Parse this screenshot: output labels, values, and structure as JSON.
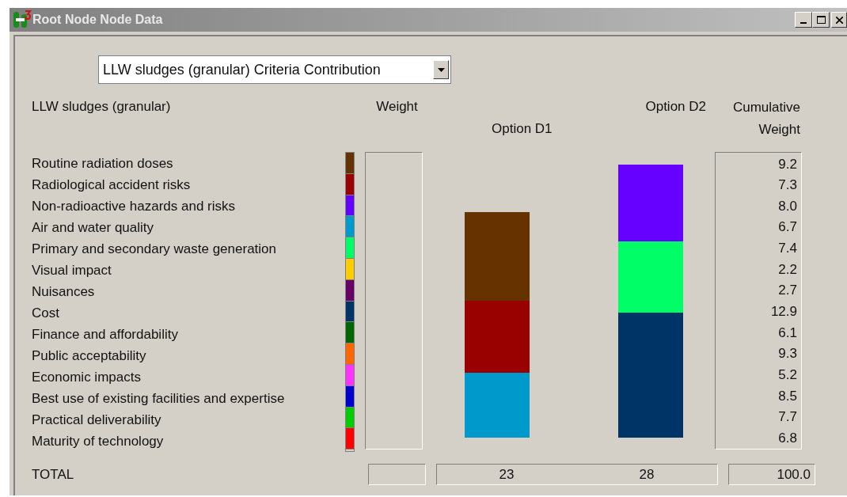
{
  "window": {
    "title": "Root Node Node Data"
  },
  "dropdown": {
    "value": "LLW sludges (granular) Criteria Contribution"
  },
  "headers": {
    "criteria": "LLW sludges (granular)",
    "weight": "Weight",
    "option_1": "Option D1",
    "option_2": "Option D2",
    "cumulative": [
      "Cumulative",
      "Weight"
    ]
  },
  "criteria": [
    {
      "name": "Routine radiation doses",
      "color": "#663300",
      "cumulative": "9.2"
    },
    {
      "name": "Radiological accident risks",
      "color": "#990000",
      "cumulative": "7.3"
    },
    {
      "name": "Non-radioactive hazards and risks",
      "color": "#6600ff",
      "cumulative": "8.0"
    },
    {
      "name": "Air and water quality",
      "color": "#0099cc",
      "cumulative": "6.7"
    },
    {
      "name": "Primary and secondary waste generation",
      "color": "#00ff66",
      "cumulative": "7.4"
    },
    {
      "name": "Visual impact",
      "color": "#ffcc00",
      "cumulative": "2.2"
    },
    {
      "name": "Nuisances",
      "color": "#660066",
      "cumulative": "2.7"
    },
    {
      "name": "Cost",
      "color": "#003366",
      "cumulative": "12.9"
    },
    {
      "name": "Finance and affordability",
      "color": "#006600",
      "cumulative": "6.1"
    },
    {
      "name": "Public acceptability",
      "color": "#ff6600",
      "cumulative": "9.3"
    },
    {
      "name": "Economic impacts",
      "color": "#ff33ff",
      "cumulative": "5.2"
    },
    {
      "name": "Best use of existing facilities and expertise",
      "color": "#0000cc",
      "cumulative": "8.5"
    },
    {
      "name": "Practical deliverability",
      "color": "#00cc00",
      "cumulative": "7.7"
    },
    {
      "name": "Maturity of technology",
      "color": "#ff0000",
      "cumulative": "6.8"
    }
  ],
  "options": [
    {
      "total": "23",
      "segments": [
        {
          "color": "#663300"
        },
        {
          "color": "#990000"
        },
        {
          "color": "#0099cc"
        }
      ]
    },
    {
      "total": "28",
      "segments": [
        {
          "color": "#6600ff"
        },
        {
          "color": "#00ff66"
        },
        {
          "color": "#003366"
        }
      ]
    }
  ],
  "total": {
    "label": "TOTAL",
    "cumulative": "100.0"
  }
}
